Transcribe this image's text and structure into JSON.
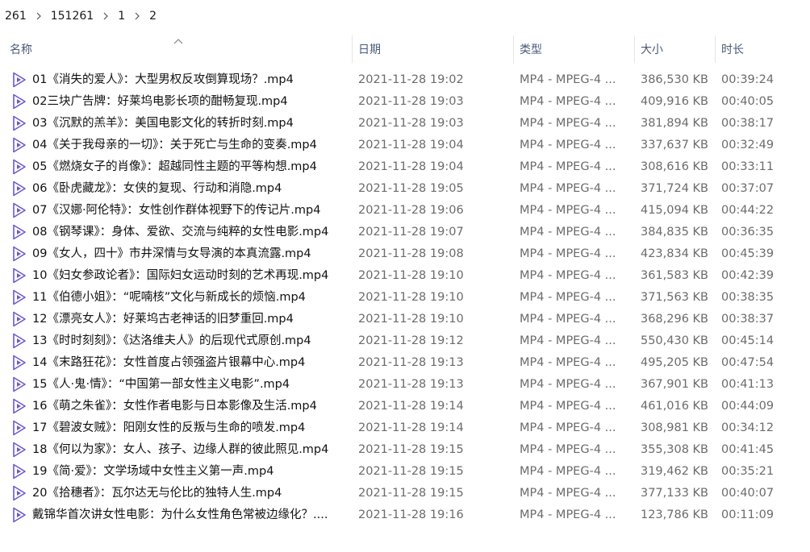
{
  "breadcrumb": [
    "261",
    "151261",
    "1",
    "2"
  ],
  "columns": {
    "name": "名称",
    "date": "日期",
    "type": "类型",
    "size": "大小",
    "duration": "时长"
  },
  "files": [
    {
      "name": "01《消失的爱人》：大型男权反攻倒算现场？.mp4",
      "date": "2021-11-28 19:02",
      "type": "MP4 - MPEG-4 ...",
      "size": "386,530 KB",
      "duration": "00:39:24"
    },
    {
      "name": "02三块广告牌：好莱坞电影长项的酣畅复现.mp4",
      "date": "2021-11-28 19:03",
      "type": "MP4 - MPEG-4 ...",
      "size": "409,916 KB",
      "duration": "00:40:05"
    },
    {
      "name": "03《沉默的羔羊》：美国电影文化的转折时刻.mp4",
      "date": "2021-11-28 19:03",
      "type": "MP4 - MPEG-4 ...",
      "size": "381,894 KB",
      "duration": "00:38:17"
    },
    {
      "name": "04《关于我母亲的一切》：关于死亡与生命的变奏.mp4",
      "date": "2021-11-28 19:04",
      "type": "MP4 - MPEG-4 ...",
      "size": "337,637 KB",
      "duration": "00:32:49"
    },
    {
      "name": "05《燃烧女子的肖像》：超越同性主题的平等构想.mp4",
      "date": "2021-11-28 19:04",
      "type": "MP4 - MPEG-4 ...",
      "size": "308,616 KB",
      "duration": "00:33:11"
    },
    {
      "name": "06《卧虎藏龙》：女侠的复现、行动和消隐.mp4",
      "date": "2021-11-28 19:05",
      "type": "MP4 - MPEG-4 ...",
      "size": "371,724 KB",
      "duration": "00:37:07"
    },
    {
      "name": "07《汉娜·阿伦特》：女性创作群体视野下的传记片.mp4",
      "date": "2021-11-28 19:06",
      "type": "MP4 - MPEG-4 ...",
      "size": "415,094 KB",
      "duration": "00:44:22"
    },
    {
      "name": "08《钢琴课》：身体、爱欲、交流与纯粹的女性电影.mp4",
      "date": "2021-11-28 19:07",
      "type": "MP4 - MPEG-4 ...",
      "size": "384,835 KB",
      "duration": "00:36:35"
    },
    {
      "name": "09《女人，四十》市井深情与女导演的本真流露.mp4",
      "date": "2021-11-28 19:08",
      "type": "MP4 - MPEG-4 ...",
      "size": "423,834 KB",
      "duration": "00:45:39"
    },
    {
      "name": "10《妇女参政论者》：国际妇女运动时刻的艺术再现.mp4",
      "date": "2021-11-28 19:10",
      "type": "MP4 - MPEG-4 ...",
      "size": "361,583 KB",
      "duration": "00:42:39"
    },
    {
      "name": "11《伯德小姐》：“呢喃核”文化与新成长的烦恼.mp4",
      "date": "2021-11-28 19:10",
      "type": "MP4 - MPEG-4 ...",
      "size": "371,563 KB",
      "duration": "00:38:35"
    },
    {
      "name": "12《漂亮女人》：好莱坞古老神话的旧梦重回.mp4",
      "date": "2021-11-28 19:10",
      "type": "MP4 - MPEG-4 ...",
      "size": "368,296 KB",
      "duration": "00:38:37"
    },
    {
      "name": "13《时时刻刻》：《达洛维夫人》的后现代式原创.mp4",
      "date": "2021-11-28 19:12",
      "type": "MP4 - MPEG-4 ...",
      "size": "550,430 KB",
      "duration": "00:45:14"
    },
    {
      "name": "14《末路狂花》：女性首度占领强盗片银幕中心.mp4",
      "date": "2021-11-28 19:13",
      "type": "MP4 - MPEG-4 ...",
      "size": "495,205 KB",
      "duration": "00:47:54"
    },
    {
      "name": "15《人·鬼·情》：“中国第一部女性主义电影”.mp4",
      "date": "2021-11-28 19:13",
      "type": "MP4 - MPEG-4 ...",
      "size": "367,901 KB",
      "duration": "00:41:13"
    },
    {
      "name": "16《萌之朱雀》：女性作者电影与日本影像及生活.mp4",
      "date": "2021-11-28 19:14",
      "type": "MP4 - MPEG-4 ...",
      "size": "461,016 KB",
      "duration": "00:44:09"
    },
    {
      "name": "17《碧波女贼》：阳刚女性的反叛与生命的喷发.mp4",
      "date": "2021-11-28 19:14",
      "type": "MP4 - MPEG-4 ...",
      "size": "308,981 KB",
      "duration": "00:34:12"
    },
    {
      "name": "18《何以为家》：女人、孩子、边缘人群的彼此照见.mp4",
      "date": "2021-11-28 19:15",
      "type": "MP4 - MPEG-4 ...",
      "size": "355,308 KB",
      "duration": "00:41:45"
    },
    {
      "name": "19《简·爱》：文学场域中女性主义第一声.mp4",
      "date": "2021-11-28 19:15",
      "type": "MP4 - MPEG-4 ...",
      "size": "319,462 KB",
      "duration": "00:35:21"
    },
    {
      "name": "20《拾穗者》：瓦尔达无与伦比的独特人生.mp4",
      "date": "2021-11-28 19:15",
      "type": "MP4 - MPEG-4 ...",
      "size": "377,133 KB",
      "duration": "00:40:07"
    },
    {
      "name": "戴锦华首次讲女性电影：为什么女性角色常被边缘化？....",
      "date": "2021-11-28 19:16",
      "type": "MP4 - MPEG-4 ...",
      "size": "123,786 KB",
      "duration": "00:11:09"
    }
  ],
  "colors": {
    "icon_accent": "#6a5acd",
    "header_text": "#4a5a7a",
    "meta_text": "#6b6b6b"
  },
  "icons": {
    "file": "video-file-icon",
    "separator": "chevron-right-icon",
    "sort": "sort-ascending-icon"
  }
}
